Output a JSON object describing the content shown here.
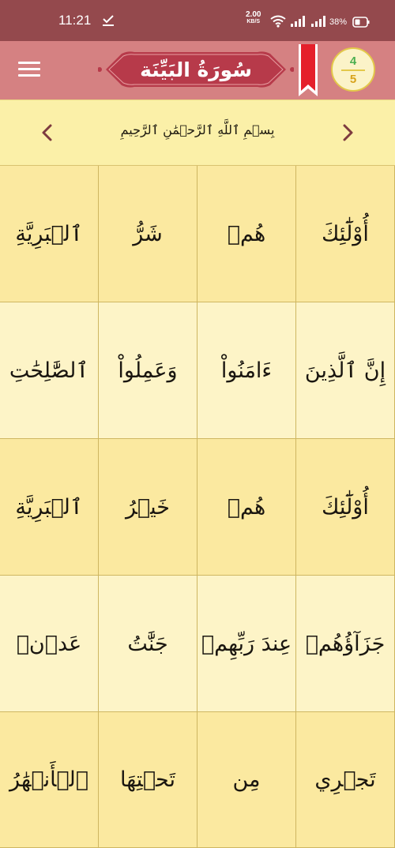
{
  "status_bar": {
    "time": "11:21",
    "net_speed_value": "2.00",
    "net_speed_unit": "KB/S",
    "battery": "38%",
    "icons": [
      "download-check-icon",
      "wifi-icon",
      "signal-icon",
      "signal-icon",
      "battery-icon"
    ]
  },
  "app_bar": {
    "title": "سُورَةُ البَيِّنَة",
    "page_current": "4",
    "page_total": "5",
    "icons": [
      "menu-icon",
      "bookmark-icon"
    ],
    "colors": {
      "status_bar": "#94494d",
      "app_bar": "#d58182",
      "banner": "#b73a4a",
      "bookmark": "#e5202b"
    }
  },
  "basmala_bar": {
    "text": "بِسۡمِ ٱللَّهِ ٱلرَّحۡمَٰنِ ٱلرَّحِيمِ",
    "icons": [
      "chevron-left-icon",
      "chevron-right-icon"
    ]
  },
  "words": [
    [
      "أُوْلَٰٓئِكَ",
      "هُمۡ",
      "شَرُّ",
      "ٱلۡبَرِيَّةِ"
    ],
    [
      "إِنَّ ٱلَّذِينَ",
      "ءَامَنُواْ",
      "وَعَمِلُواْ",
      "ٱلصَّٰلِحَٰتِ"
    ],
    [
      "أُوْلَٰٓئِكَ",
      "هُمۡ",
      "خَيۡرُ",
      "ٱلۡبَرِيَّةِ"
    ],
    [
      "جَزَآؤُهُمۡ",
      "عِندَ رَبِّهِمۡ",
      "جَنَّٰتُ",
      "عَدۡنٖ"
    ],
    [
      "تَجۡرِي",
      "مِن",
      "تَحۡتِهَا",
      "ٱلۡأَنۡهَٰرُ"
    ]
  ]
}
